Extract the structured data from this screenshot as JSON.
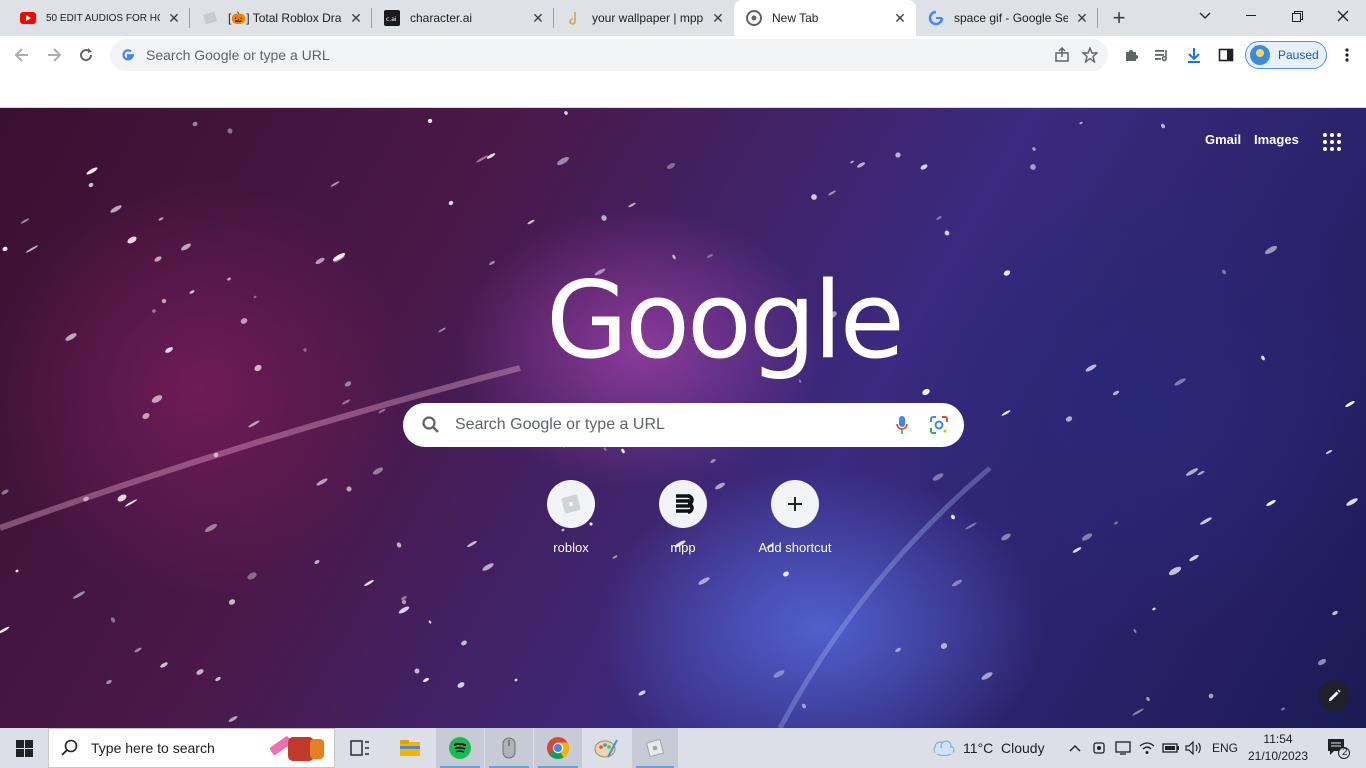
{
  "tabs": [
    {
      "title": "50 EDIT AUDIOS FOR HO",
      "favicon": "youtube-icon",
      "active": false
    },
    {
      "title": "[🎃] Total Roblox Dra",
      "favicon": "roblox-page-icon",
      "active": false
    },
    {
      "title": "character.ai",
      "favicon": "character-ai-icon",
      "active": false
    },
    {
      "title": "your wallpaper | mpp",
      "favicon": "mpp-icon",
      "active": false
    },
    {
      "title": "New Tab",
      "favicon": "chrome-icon",
      "active": true
    },
    {
      "title": "space gif - Google Se",
      "favicon": "google-icon",
      "active": false
    }
  ],
  "omnibox": {
    "placeholder": "Search Google or type a URL"
  },
  "profile": {
    "label": "Paused"
  },
  "ntp": {
    "gmail": "Gmail",
    "images": "Images",
    "logo": "Google",
    "search_placeholder": "Search Google or type a URL",
    "shortcuts": [
      {
        "label": "roblox",
        "icon": "roblox-icon"
      },
      {
        "label": "mpp",
        "icon": "mpp-icon"
      },
      {
        "label": "Add shortcut",
        "icon": "plus-icon"
      }
    ]
  },
  "taskbar": {
    "search_placeholder": "Type here to search",
    "weather_temp": "11°C",
    "weather_desc": "Cloudy",
    "language": "ENG",
    "time": "11:54",
    "date": "21/10/2023",
    "notifications": "2"
  },
  "colors": {
    "accent": "#1a73e8",
    "tab_strip": "#dee1e6",
    "taskbar": "#dcdfe8"
  }
}
